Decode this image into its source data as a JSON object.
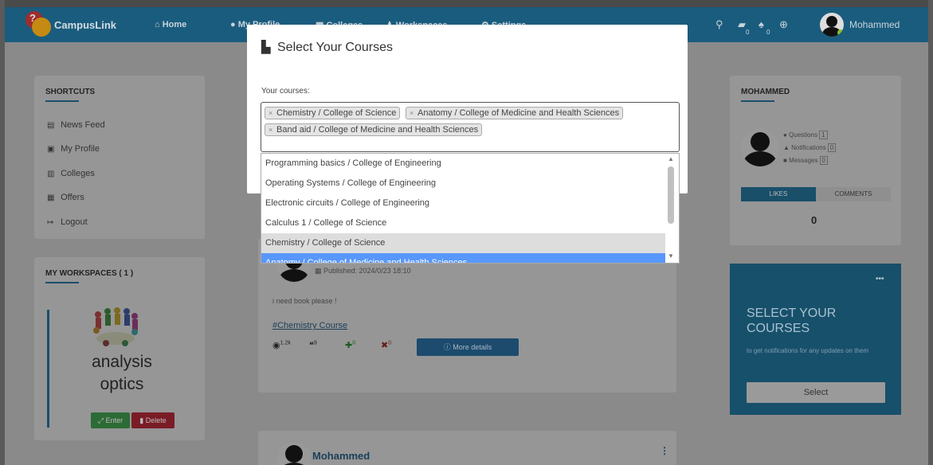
{
  "navbar": {
    "brand": "CampusLink",
    "home": "Home",
    "profile": "My Profile",
    "colleges": "Colleges",
    "workspaces": "Workspaces",
    "settings": "Settings",
    "chat_count": "0",
    "notif_count": "0",
    "user": "Mohammed"
  },
  "shortcuts": {
    "title": "SHORTCUTS",
    "items": [
      "News Feed",
      "My Profile",
      "Colleges",
      "Offers",
      "Logout"
    ]
  },
  "workspaces": {
    "title": "MY WORKSPACES ( 1 )",
    "name_line1": "analysis",
    "name_line2": "optics",
    "enter": "Enter",
    "delete": "Delete"
  },
  "post": {
    "published": "Published: 2024/0/23 18:10",
    "text": "i need book please !",
    "tag": "#Chemistry Course",
    "views": "1.2k",
    "comments": "9",
    "likes": "0",
    "dislikes": "0",
    "more": "More details"
  },
  "post2": {
    "author": "Mohammed"
  },
  "profile_card": {
    "title": "MOHAMMED",
    "questions": "Questions",
    "questions_count": "1",
    "notifications": "Notifications",
    "notifications_count": "0",
    "messages": "Messages",
    "messages_count": "0",
    "tab_likes": "LIKES",
    "tab_comments": "COMMENTS",
    "count": "0"
  },
  "promo": {
    "dots": "•••",
    "title": "SELECT YOUR COURSES",
    "subtitle": "to get notifications for any updates on them",
    "button": "Select"
  },
  "modal": {
    "title": "Select Your Courses",
    "label": "Your courses:",
    "selected": [
      "Chemistry / College of Science",
      "Anatomy / College of Medicine and Health Sciences",
      "Band aid / College of Medicine and Health Sciences"
    ],
    "options": [
      "Programming basics / College of Engineering",
      "Operating Systems / College of Engineering",
      "Electronic circuits / College of Engineering",
      "Calculus 1 / College of Science",
      "Chemistry / College of Science",
      "Anatomy / College of Medicine and Health Sciences"
    ]
  }
}
